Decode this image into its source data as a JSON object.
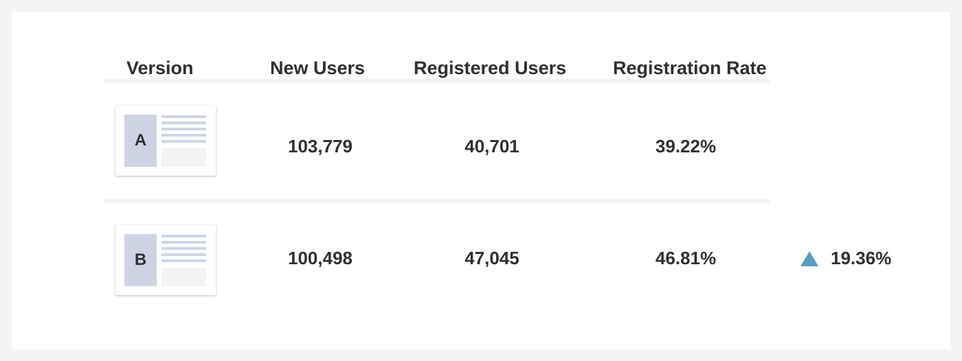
{
  "table": {
    "headers": {
      "version": "Version",
      "new_users": "New Users",
      "registered_users": "Registered Users",
      "registration_rate": "Registration Rate"
    },
    "rows": [
      {
        "version": "A",
        "new_users": "103,779",
        "registered_users": "40,701",
        "registration_rate": "39.22%"
      },
      {
        "version": "B",
        "new_users": "100,498",
        "registered_users": "47,045",
        "registration_rate": "46.81%",
        "uplift": "19.36%",
        "uplift_icon": "triangle-up-icon"
      }
    ]
  },
  "colors": {
    "uplift_triangle": "#5b9cc3",
    "thumb_panel": "#ced3e4",
    "text": "#2f2f33",
    "divider": "#f3f3f3"
  }
}
